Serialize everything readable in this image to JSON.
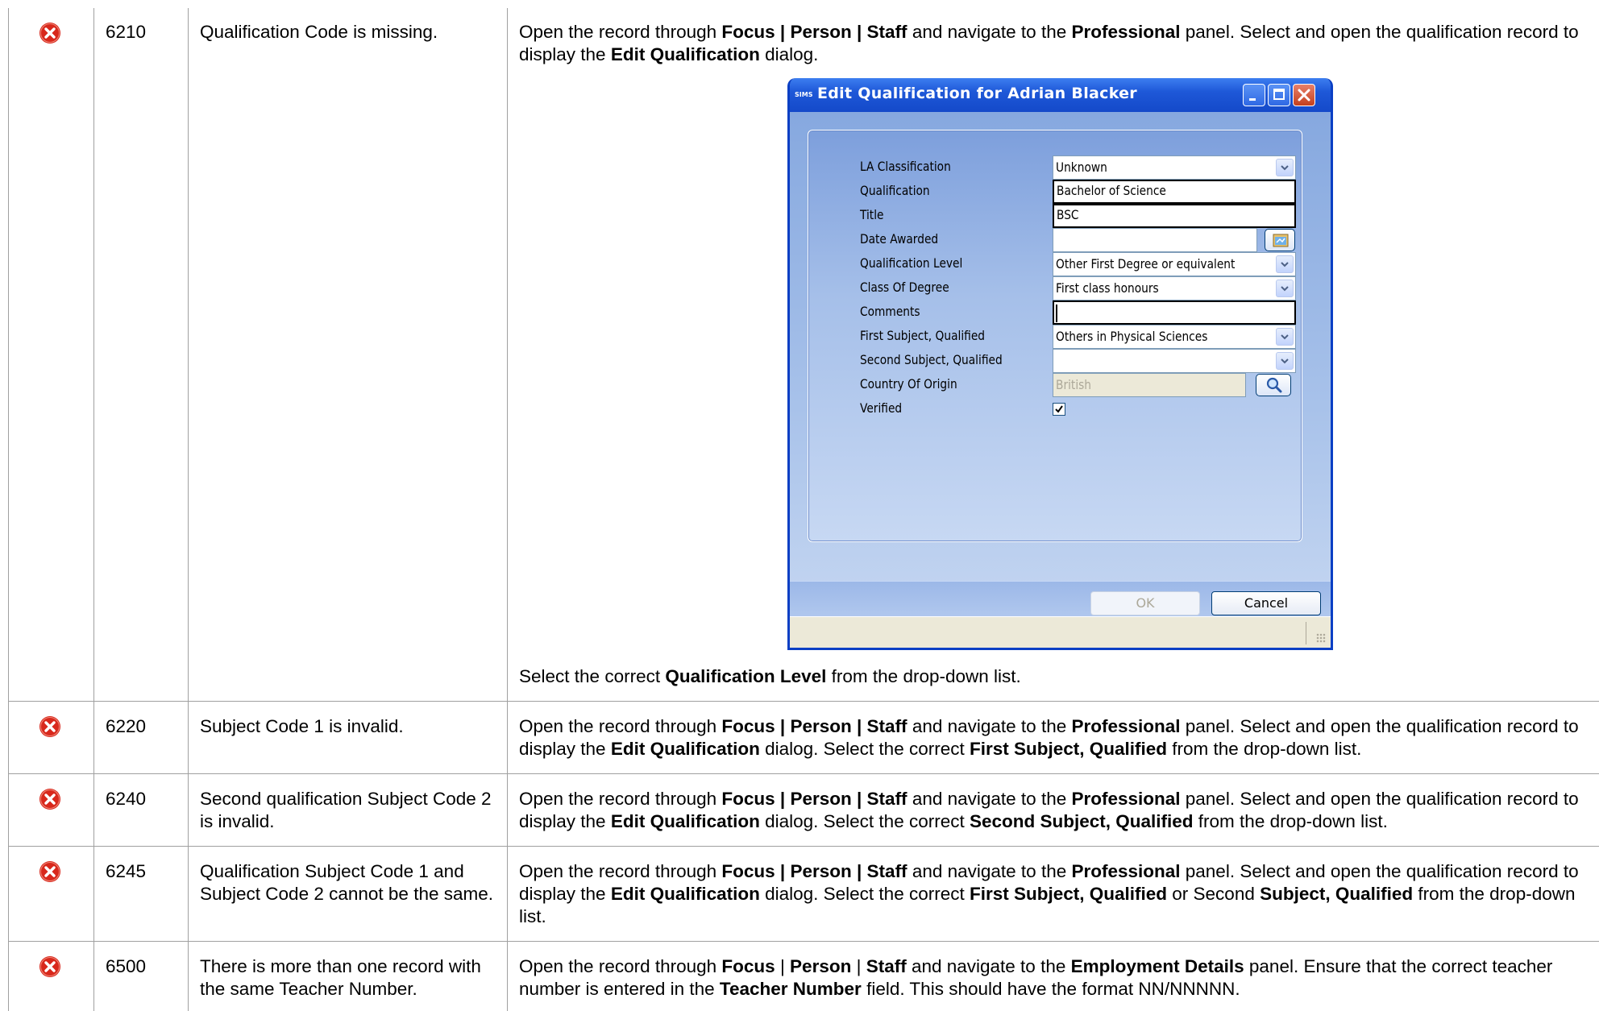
{
  "rows": [
    {
      "code": "6210",
      "message": "Qualification Code is missing.",
      "action_segments": [
        {
          "t": "Open the record through "
        },
        {
          "t": "Focus | Person | Staff",
          "b": true
        },
        {
          "t": " and navigate to the "
        },
        {
          "t": "Professional",
          "b": true
        },
        {
          "t": " panel. Select and open the qualification record to display the "
        },
        {
          "t": "Edit Qualification",
          "b": true
        },
        {
          "t": " dialog."
        }
      ],
      "after_segments": [
        {
          "t": "Select the correct "
        },
        {
          "t": "Qualification Level",
          "b": true
        },
        {
          "t": " from the drop-down list."
        }
      ]
    },
    {
      "code": "6220",
      "message": "Subject Code 1 is invalid.",
      "action_segments": [
        {
          "t": "Open the record through "
        },
        {
          "t": "Focus | Person | Staff",
          "b": true
        },
        {
          "t": " and navigate to the "
        },
        {
          "t": "Professional",
          "b": true
        },
        {
          "t": " panel. Select and open the qualification record to display the "
        },
        {
          "t": "Edit Qualification",
          "b": true
        },
        {
          "t": " dialog. Select the correct "
        },
        {
          "t": "First Subject, Qualified",
          "b": true
        },
        {
          "t": " from the drop-down list."
        }
      ]
    },
    {
      "code": "6240",
      "message": "Second qualification Subject Code 2 is invalid.",
      "action_segments": [
        {
          "t": "Open the record through "
        },
        {
          "t": "Focus | Person | Staff",
          "b": true
        },
        {
          "t": " and navigate to the "
        },
        {
          "t": "Professional",
          "b": true
        },
        {
          "t": " panel. Select and open the qualification record to display the "
        },
        {
          "t": "Edit Qualification",
          "b": true
        },
        {
          "t": " dialog. Select the correct "
        },
        {
          "t": "Second Subject, Qualified",
          "b": true
        },
        {
          "t": " from the drop-down list."
        }
      ]
    },
    {
      "code": "6245",
      "message": "Qualification Subject Code 1 and Subject Code 2 cannot be the same.",
      "action_segments": [
        {
          "t": "Open the record through "
        },
        {
          "t": "Focus | Person | Staff",
          "b": true
        },
        {
          "t": " and navigate to the "
        },
        {
          "t": "Professional",
          "b": true
        },
        {
          "t": " panel. Select and open the qualification record to display the "
        },
        {
          "t": "Edit Qualification",
          "b": true
        },
        {
          "t": " dialog. Select the correct "
        },
        {
          "t": "First Subject, Qualified",
          "b": true
        },
        {
          "t": " or Second "
        },
        {
          "t": "Subject, Qualified",
          "b": true
        },
        {
          "t": " from the drop-down list."
        }
      ]
    },
    {
      "code": "6500",
      "message": "There is more than one record with the same Teacher Number.",
      "action_segments": [
        {
          "t": "Open the record through "
        },
        {
          "t": "Focus",
          "b": true
        },
        {
          "t": " | "
        },
        {
          "t": "Person",
          "b": true
        },
        {
          "t": " | "
        },
        {
          "t": "Staff",
          "b": true
        },
        {
          "t": " and navigate to the "
        },
        {
          "t": "Employment Details",
          "b": true
        },
        {
          "t": " panel. Ensure that the correct teacher number is entered in the "
        },
        {
          "t": "Teacher Number",
          "b": true
        },
        {
          "t": " field. This should have the format NN/NNNNN."
        }
      ]
    }
  ],
  "icons": {
    "error": "error-icon",
    "error_color": "#d8281c"
  },
  "dialog": {
    "logo": "SIMS",
    "title": "Edit Qualification for Adrian Blacker",
    "fields": {
      "la_classification": {
        "label": "LA Classification",
        "value": "Unknown"
      },
      "qualification": {
        "label": "Qualification",
        "value": "Bachelor of Science"
      },
      "title": {
        "label": "Title",
        "value": "BSC"
      },
      "date_awarded": {
        "label": "Date Awarded",
        "value": ""
      },
      "qualification_level": {
        "label": "Qualification Level",
        "value": "Other First Degree or equivalent"
      },
      "class_of_degree": {
        "label": "Class Of Degree",
        "value": "First class honours"
      },
      "comments": {
        "label": "Comments",
        "value": ""
      },
      "first_subject": {
        "label": "First Subject, Qualified",
        "value": "Others in Physical Sciences"
      },
      "second_subject": {
        "label": "Second Subject, Qualified",
        "value": ""
      },
      "country_of_origin": {
        "label": "Country Of Origin",
        "value": "British"
      },
      "verified": {
        "label": "Verified",
        "checked": true
      }
    },
    "ok_label": "OK",
    "cancel_label": "Cancel"
  }
}
